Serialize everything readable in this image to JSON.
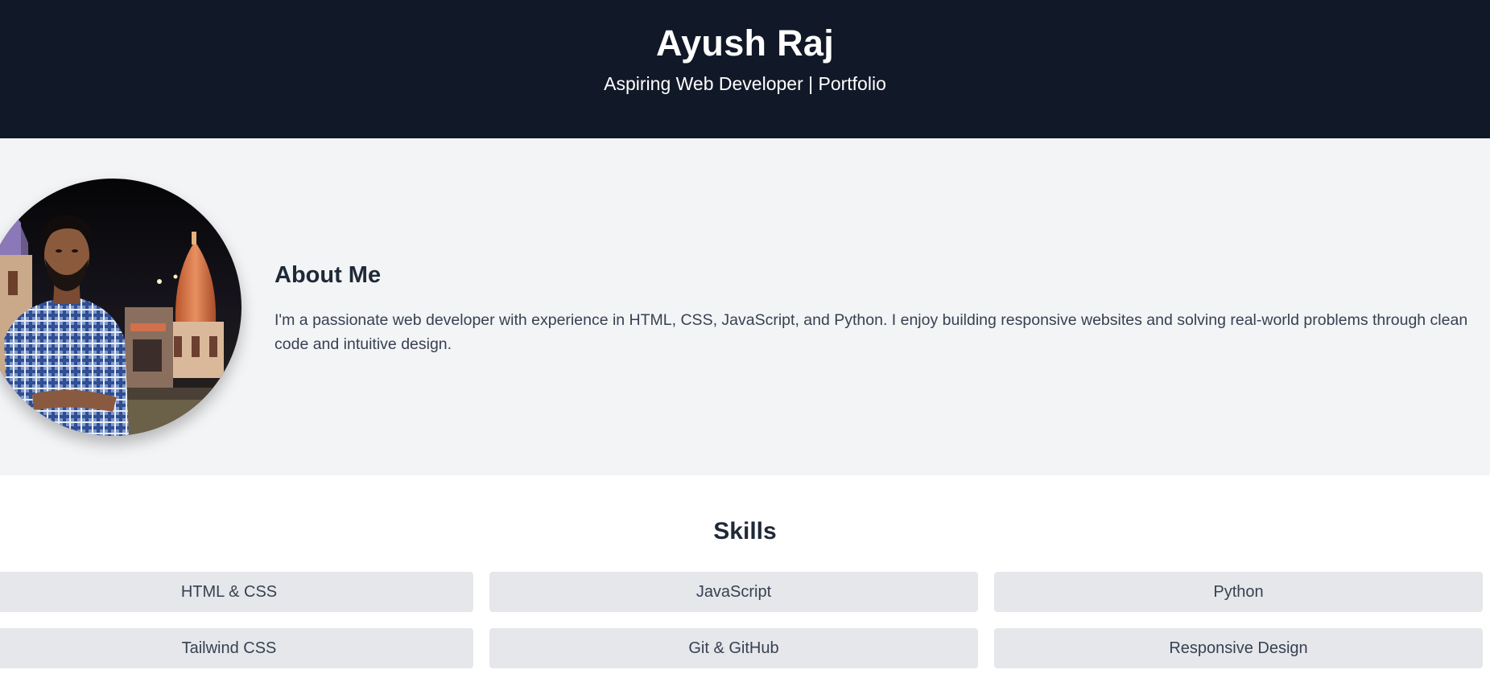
{
  "header": {
    "title": "Ayush Raj",
    "subtitle": "Aspiring Web Developer | Portfolio"
  },
  "about": {
    "heading": "About Me",
    "text": "I'm a passionate web developer with experience in HTML, CSS, JavaScript, and Python. I enjoy building responsive websites and solving real-world problems through clean code and intuitive design."
  },
  "skills": {
    "heading": "Skills",
    "items": [
      "HTML & CSS",
      "JavaScript",
      "Python",
      "Tailwind CSS",
      "Git & GitHub",
      "Responsive Design"
    ]
  },
  "colors": {
    "header_bg": "#111827",
    "about_bg": "#f3f4f6",
    "skill_card_bg": "#e5e7eb",
    "text_dark": "#1f2937"
  }
}
